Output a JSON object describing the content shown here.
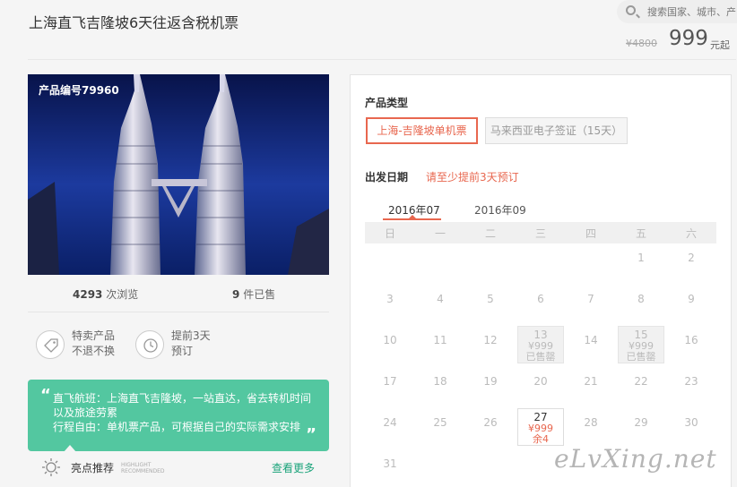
{
  "header": {
    "title": "上海直飞吉隆坡6天往返含税机票",
    "search_placeholder": "搜索国家、城市、产",
    "old_price": "¥4800",
    "price": "999",
    "price_unit": "元起"
  },
  "product": {
    "code": "产品编号79960",
    "views": "4293",
    "views_label": "次浏览",
    "sold": "9",
    "sold_label": "件已售"
  },
  "features": [
    {
      "icon": "tag-icon",
      "line1": "特卖产品",
      "line2": "不退不换"
    },
    {
      "icon": "clock-icon",
      "line1": "提前3天",
      "line2": "预订"
    }
  ],
  "highlight": {
    "line1": "直飞航班：上海直飞吉隆坡，一站直达，省去转机时间以及旅途劳累",
    "line2": "行程自由：单机票产品，可根据自己的实际需求安排",
    "label": "亮点推荐",
    "label_en_1": "HIGHLIGHT",
    "label_en_2": "RECOMMENDED",
    "more": "查看更多"
  },
  "booking": {
    "type_label": "产品类型",
    "options": [
      "上海-吉隆坡单机票",
      "马来西亚电子签证（15天）"
    ],
    "selected_option": 0,
    "date_label": "出发日期",
    "date_note": "请至少提前3天预订",
    "months": [
      "2016年07",
      "2016年09"
    ],
    "active_month": 0,
    "weekdays": [
      "日",
      "一",
      "二",
      "三",
      "四",
      "五",
      "六"
    ],
    "days": [
      {
        "n": "1",
        "col": 5,
        "row": 0
      },
      {
        "n": "2",
        "col": 6,
        "row": 0
      },
      {
        "n": "3",
        "col": 0,
        "row": 1
      },
      {
        "n": "4",
        "col": 1,
        "row": 1
      },
      {
        "n": "5",
        "col": 2,
        "row": 1
      },
      {
        "n": "6",
        "col": 3,
        "row": 1
      },
      {
        "n": "7",
        "col": 4,
        "row": 1
      },
      {
        "n": "8",
        "col": 5,
        "row": 1
      },
      {
        "n": "9",
        "col": 6,
        "row": 1
      },
      {
        "n": "10",
        "col": 0,
        "row": 2
      },
      {
        "n": "11",
        "col": 1,
        "row": 2
      },
      {
        "n": "12",
        "col": 2,
        "row": 2
      },
      {
        "n": "13",
        "col": 3,
        "row": 2,
        "state": "soldout",
        "price": "¥999",
        "status": "已售罄"
      },
      {
        "n": "14",
        "col": 4,
        "row": 2
      },
      {
        "n": "15",
        "col": 5,
        "row": 2,
        "state": "soldout",
        "price": "¥999",
        "status": "已售罄"
      },
      {
        "n": "16",
        "col": 6,
        "row": 2
      },
      {
        "n": "17",
        "col": 0,
        "row": 3
      },
      {
        "n": "18",
        "col": 1,
        "row": 3
      },
      {
        "n": "19",
        "col": 2,
        "row": 3
      },
      {
        "n": "20",
        "col": 3,
        "row": 3
      },
      {
        "n": "21",
        "col": 4,
        "row": 3
      },
      {
        "n": "22",
        "col": 5,
        "row": 3
      },
      {
        "n": "23",
        "col": 6,
        "row": 3
      },
      {
        "n": "24",
        "col": 0,
        "row": 4
      },
      {
        "n": "25",
        "col": 1,
        "row": 4
      },
      {
        "n": "26",
        "col": 2,
        "row": 4
      },
      {
        "n": "27",
        "col": 3,
        "row": 4,
        "state": "avail",
        "price": "¥999",
        "status": "余4"
      },
      {
        "n": "28",
        "col": 4,
        "row": 4
      },
      {
        "n": "29",
        "col": 5,
        "row": 4
      },
      {
        "n": "30",
        "col": 6,
        "row": 4
      },
      {
        "n": "31",
        "col": 0,
        "row": 5
      }
    ]
  },
  "watermark": "eLvXing.net",
  "colors": {
    "accent": "#e8674f",
    "highlight_bg": "#53c7a0",
    "link": "#1aa37a"
  }
}
